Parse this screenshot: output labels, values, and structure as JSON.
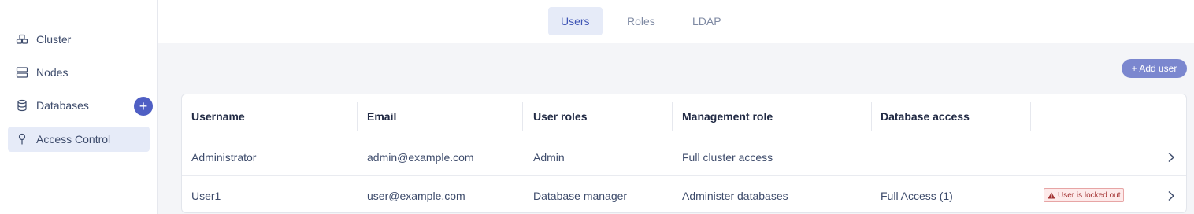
{
  "sidebar": {
    "items": [
      {
        "label": "Cluster",
        "icon": "cluster-icon"
      },
      {
        "label": "Nodes",
        "icon": "nodes-icon"
      },
      {
        "label": "Databases",
        "icon": "database-icon"
      },
      {
        "label": "Access Control",
        "icon": "access-control-icon",
        "active": true
      }
    ],
    "add_database_label": "+"
  },
  "tabs": [
    {
      "label": "Users",
      "active": true
    },
    {
      "label": "Roles"
    },
    {
      "label": "LDAP"
    }
  ],
  "toolbar": {
    "add_user_label": "+ Add user"
  },
  "table": {
    "columns": [
      "Username",
      "Email",
      "User roles",
      "Management role",
      "Database access"
    ],
    "rows": [
      {
        "username": "Administrator",
        "email": "admin@example.com",
        "user_roles": "Admin",
        "management_role": "Full cluster access",
        "database_access": "",
        "status": ""
      },
      {
        "username": "User1",
        "email": "user@example.com",
        "user_roles": "Database manager",
        "management_role": "Administer databases",
        "database_access": "Full Access (1)",
        "status": "User is locked out"
      }
    ]
  },
  "colors": {
    "accent": "#4f5fc4",
    "active_bg": "#e6ebf8",
    "warning": "#a33232"
  }
}
